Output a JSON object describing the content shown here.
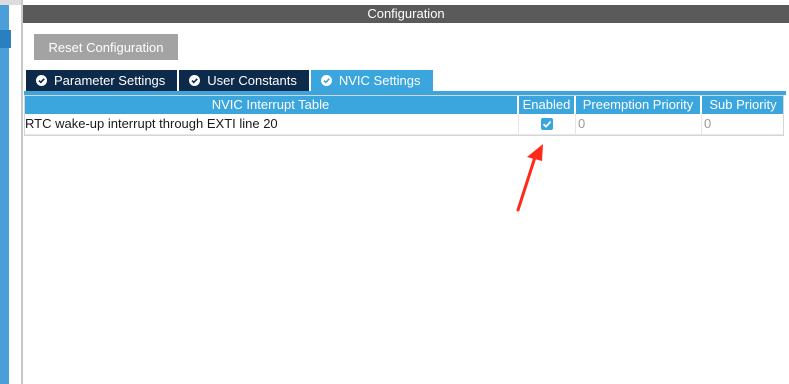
{
  "window": {
    "title": "Configuration"
  },
  "toolbar": {
    "reset_label": "Reset Configuration"
  },
  "tabs": [
    {
      "label": "Parameter Settings",
      "active": false,
      "icon": "check-circle-icon"
    },
    {
      "label": "User Constants",
      "active": false,
      "icon": "check-circle-icon"
    },
    {
      "label": "NVIC Settings",
      "active": true,
      "icon": "check-circle-icon"
    }
  ],
  "table": {
    "headers": [
      "NVIC Interrupt Table",
      "Enabled",
      "Preemption Priority",
      "Sub Priority"
    ],
    "rows": [
      {
        "name": "RTC wake-up interrupt through EXTI line 20",
        "enabled": true,
        "preemption": "0",
        "sub": "0"
      }
    ]
  },
  "colors": {
    "accent": "#3ba5de",
    "tab_inactive": "#0d2a4a",
    "title_bar": "#5a5a5a",
    "button": "#a3a3a3",
    "annotation_arrow": "#ff2a1a"
  }
}
